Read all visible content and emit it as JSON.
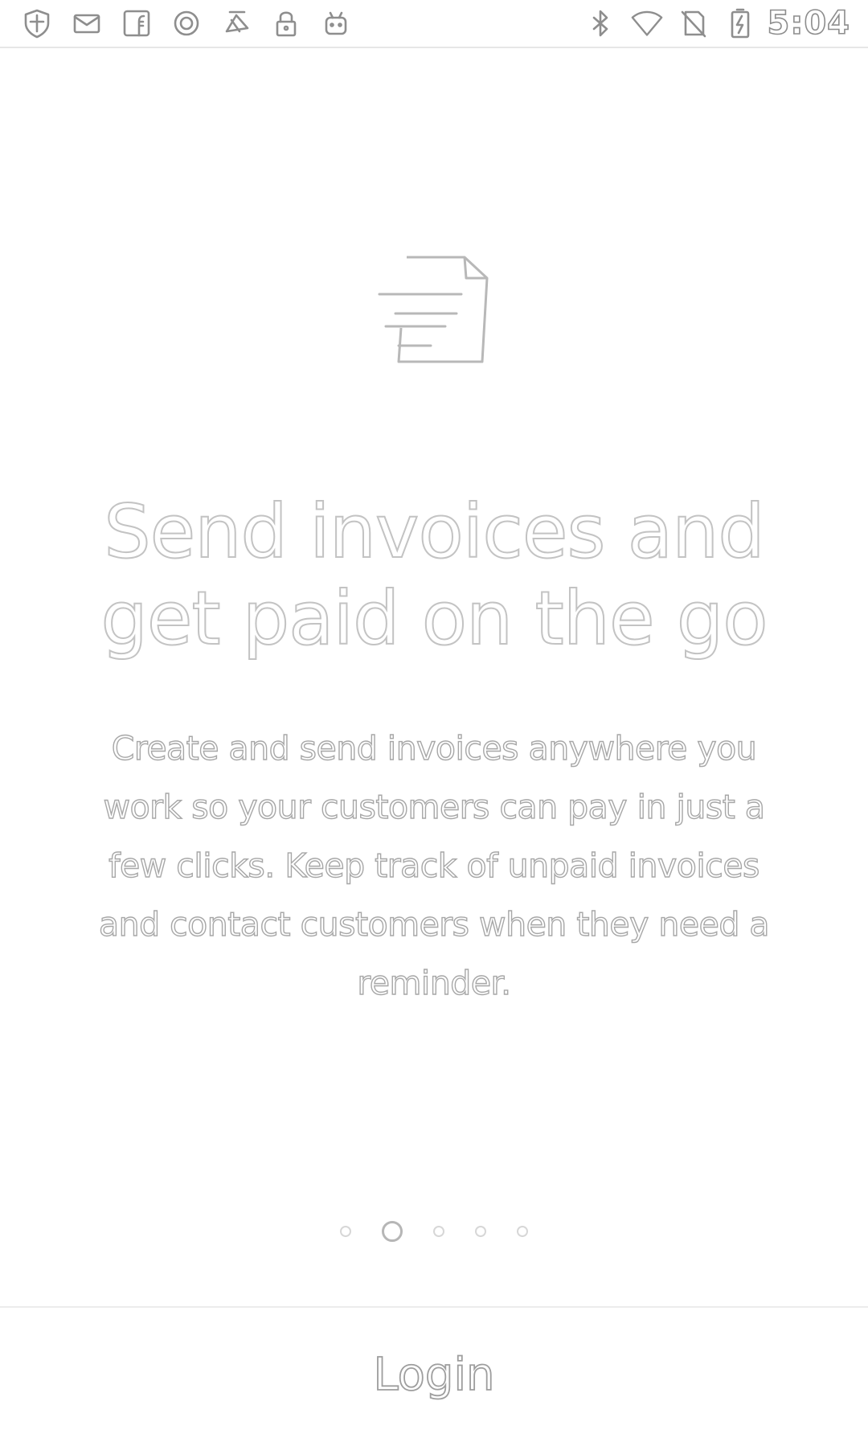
{
  "status_bar": {
    "left_icons": [
      "shield-icon",
      "email-icon",
      "facebook-icon",
      "circle-app-icon",
      "fax-icon",
      "lock-icon",
      "android-icon"
    ],
    "right_icons": [
      "bluetooth-icon",
      "wifi-icon",
      "no-sim-icon",
      "battery-charging-icon"
    ],
    "time": "5:04"
  },
  "onboarding": {
    "icon": "invoice-send-icon",
    "headline": "Send invoices and get paid on the go",
    "description": "Create and send invoices anywhere you work so your customers can pay in just a few clicks. Keep track of unpaid invoices and contact customers when they need a reminder.",
    "pager": {
      "total": 5,
      "active_index": 1
    }
  },
  "footer": {
    "login_label": "Login"
  }
}
